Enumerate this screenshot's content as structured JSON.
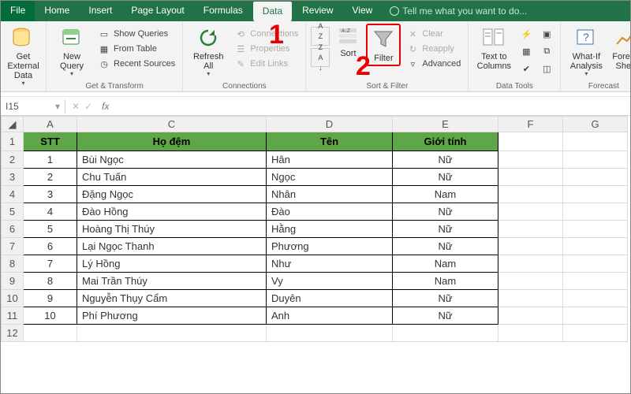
{
  "tabs": {
    "file": "File",
    "home": "Home",
    "insert": "Insert",
    "pageLayout": "Page Layout",
    "formulas": "Formulas",
    "data": "Data",
    "review": "Review",
    "view": "View",
    "tell": "Tell me what you want to do..."
  },
  "ribbon": {
    "getExternal": "Get External Data",
    "newQuery": "New Query",
    "showQueries": "Show Queries",
    "fromTable": "From Table",
    "recentSources": "Recent Sources",
    "getTransform": "Get & Transform",
    "refreshAll": "Refresh All",
    "connections": "Connections",
    "properties": "Properties",
    "editLinks": "Edit Links",
    "connectionsGroup": "Connections",
    "sort": "Sort",
    "filter": "Filter",
    "clear": "Clear",
    "reapply": "Reapply",
    "advanced": "Advanced",
    "sortFilterGroup": "Sort & Filter",
    "textToColumns": "Text to Columns",
    "dataToolsGroup": "Data Tools",
    "whatIf": "What-If Analysis",
    "forecastSheet": "Foreca Shee",
    "forecastGroup": "Forecast"
  },
  "callouts": {
    "one": "1",
    "two": "2"
  },
  "fx": {
    "namebox": "I15"
  },
  "cols": {
    "A": "A",
    "C": "C",
    "D": "D",
    "E": "E",
    "F": "F",
    "G": "G"
  },
  "headers": {
    "stt": "STT",
    "hodem": "Họ đệm",
    "ten": "Tên",
    "gioitinh": "Giới tính"
  },
  "rows": [
    {
      "n": "1",
      "stt": "1",
      "ho": "Bùi Ngọc",
      "ten": "Hân",
      "gt": "Nữ"
    },
    {
      "n": "2",
      "stt": "2",
      "ho": "Chu Tuấn",
      "ten": "Ngọc",
      "gt": "Nữ"
    },
    {
      "n": "3",
      "stt": "3",
      "ho": "Đặng Ngọc",
      "ten": "Nhân",
      "gt": "Nam"
    },
    {
      "n": "4",
      "stt": "4",
      "ho": "Đào Hồng",
      "ten": "Đào",
      "gt": "Nữ"
    },
    {
      "n": "5",
      "stt": "5",
      "ho": "Hoàng Thị Thúy",
      "ten": "Hằng",
      "gt": "Nữ"
    },
    {
      "n": "6",
      "stt": "6",
      "ho": "Lại Ngọc Thanh",
      "ten": "Phương",
      "gt": "Nữ"
    },
    {
      "n": "7",
      "stt": "7",
      "ho": "Lý Hồng",
      "ten": "Như",
      "gt": "Nam"
    },
    {
      "n": "8",
      "stt": "8",
      "ho": "Mai Trần Thúy",
      "ten": "Vy",
      "gt": "Nam"
    },
    {
      "n": "9",
      "stt": "9",
      "ho": "Nguyễn Thụy Cẩm",
      "ten": "Duyên",
      "gt": "Nữ"
    },
    {
      "n": "10",
      "stt": "10",
      "ho": "Phí Phương",
      "ten": "Anh",
      "gt": "Nữ"
    }
  ],
  "blankRows": [
    "11",
    "12"
  ]
}
